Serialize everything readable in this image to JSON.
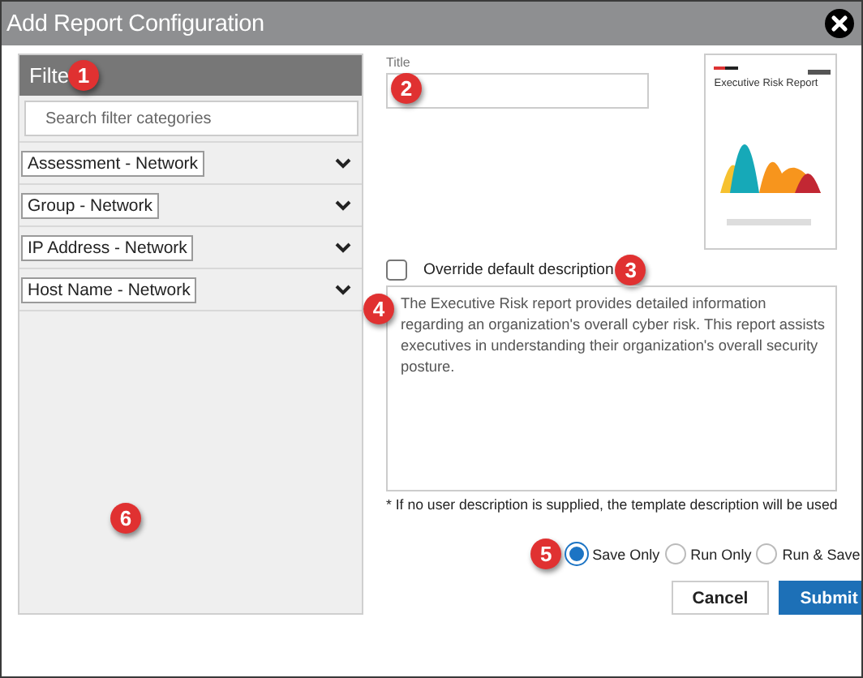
{
  "window": {
    "title": "Add Report Configuration"
  },
  "filters": {
    "heading": "Filte",
    "callout": "1",
    "panel_callout": "6",
    "search": {
      "placeholder": "Search filter categories"
    },
    "items": [
      {
        "label": "Assessment - Network",
        "expanded": false
      },
      {
        "label": "Group - Network",
        "expanded": false
      },
      {
        "label": "IP Address - Network",
        "expanded": false
      },
      {
        "label": "Host Name - Network",
        "expanded": false
      }
    ]
  },
  "title_field": {
    "label": "Title",
    "callout": "2"
  },
  "preview": {
    "title": "Executive Risk Report"
  },
  "override": {
    "label": "Override default description",
    "checked": false,
    "callout": "3"
  },
  "description": {
    "value": "The Executive Risk report provides detailed information regarding an organization's overall cyber risk. This report assists executives in understanding their organization's overall security posture.",
    "callout": "4"
  },
  "note": "* If no user description is supplied, the template description will be used",
  "actions": {
    "callout": "5",
    "options": [
      {
        "label": "Save Only",
        "selected": true
      },
      {
        "label": "Run Only",
        "selected": false
      },
      {
        "label": "Run & Save",
        "selected": false
      }
    ]
  },
  "buttons": [
    {
      "label": "Cancel",
      "kind": "secondary"
    },
    {
      "label": "Submit",
      "kind": "primary"
    }
  ]
}
